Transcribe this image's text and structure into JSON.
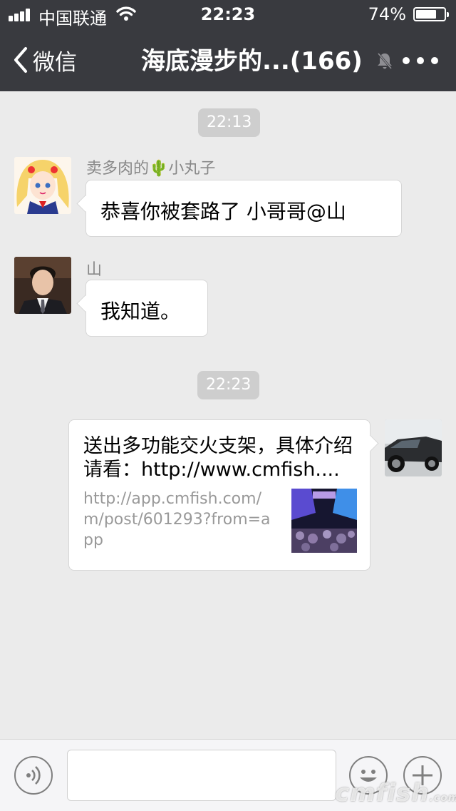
{
  "status_bar": {
    "carrier": "中国联通",
    "time": "22:23",
    "battery_percent": "74%",
    "battery_level": 0.74
  },
  "nav": {
    "back_label": "微信",
    "title": "海底漫步的...(166)"
  },
  "messages": [
    {
      "timestamp": "22:13"
    },
    {
      "sender": "卖多肉的🌵小丸子",
      "text": "恭喜你被套路了 小哥哥@山"
    },
    {
      "sender": "山",
      "text": "我知道。"
    },
    {
      "timestamp": "22:23"
    },
    {
      "link_title": "送出多功能交火支架，具体介绍请看：http://www.cmfish....",
      "link_url": "http://app.cmfish.com/m/post/601293?from=app"
    }
  ],
  "input_bar": {
    "placeholder": ""
  },
  "watermark": {
    "text": "cmfish",
    "suffix": ".com"
  },
  "colors": {
    "nav_bg": "#393a3f",
    "chat_bg": "#ebebeb",
    "bubble": "#ffffff"
  }
}
